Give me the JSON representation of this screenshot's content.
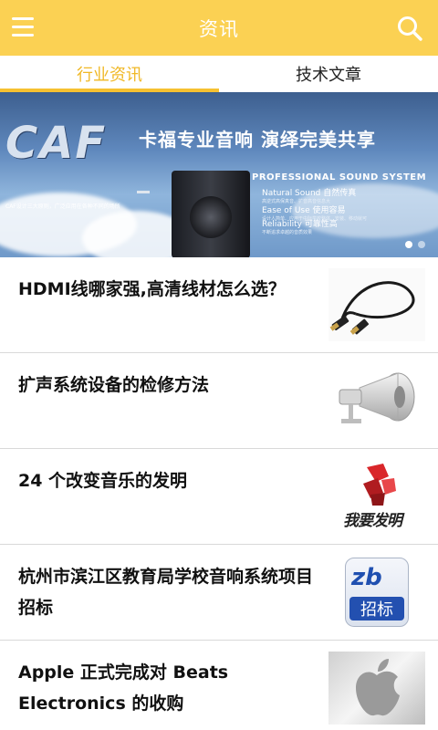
{
  "header": {
    "title": "资讯",
    "menu_icon": "hamburger-menu-icon",
    "search_icon": "search-icon",
    "background": "#fbd153"
  },
  "tabs": [
    {
      "label": "行业资讯",
      "active": true
    },
    {
      "label": "技术文章",
      "active": false
    }
  ],
  "banner": {
    "logo_text": "CAF",
    "slogan": "卡福专业音响 演绎完美共享",
    "heading": "PROFESSIONAL SOUND SYSTEM",
    "features": [
      {
        "label": "Natural Sound 自然传真",
        "sub": "高逆式高保真音、扩音高音信息大"
      },
      {
        "label": "Ease of Use 使用容易",
        "sub": "设计人简单、应用于中际学校整体、安装、移动就可"
      },
      {
        "label": "Reliability 可靠性高",
        "sub": "不断追求卓越的音质效果"
      }
    ],
    "tagline": "CAF设计三大原则，广泛应用在各种不同的场所",
    "slide_count": 2,
    "active_slide": 1
  },
  "news": [
    {
      "title": "HDMI线哪家强,高清线材怎么选？",
      "thumb": "hdmi-cable-thumbnail"
    },
    {
      "title": "扩声系统设备的检修方法",
      "thumb": "horn-speaker-thumbnail"
    },
    {
      "title": "24 个改变音乐的发明",
      "thumb": "invention-logo-thumbnail",
      "thumb_text": "我要发明"
    },
    {
      "title": "杭州市滨江区教育局学校音响系统项目招标",
      "thumb": "bidding-logo-thumbnail",
      "thumb_logo": "zb",
      "thumb_text": "招标"
    },
    {
      "title": "Apple 正式完成对 Beats Electronics 的收购",
      "thumb": "apple-logo-thumbnail"
    }
  ]
}
